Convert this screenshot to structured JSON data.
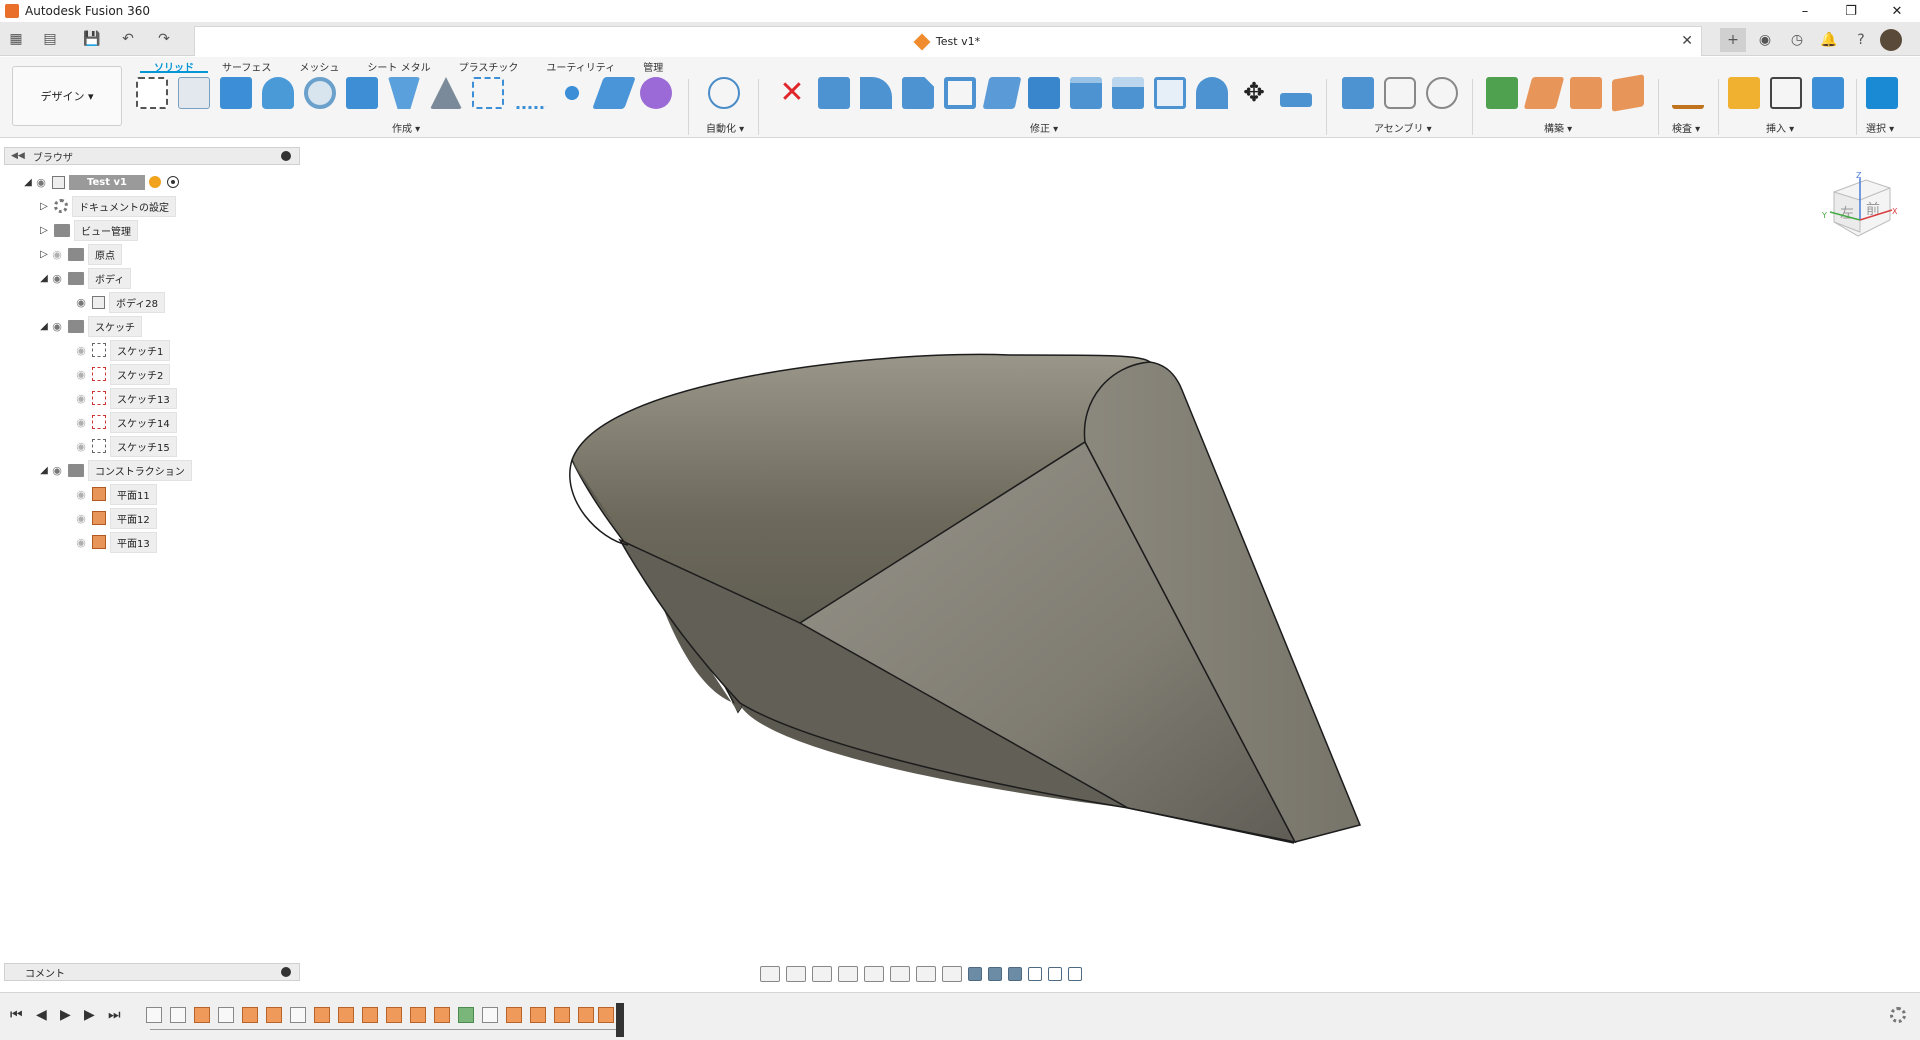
{
  "app_title": "Autodesk Fusion 360",
  "document_tab": {
    "title": "Test v1*"
  },
  "window_controls": [
    "–",
    "❐",
    "✕"
  ],
  "ribbon": {
    "workspace": "デザイン ▾",
    "tabs": [
      {
        "label": "ソリッド",
        "active": true
      },
      {
        "label": "サーフェス",
        "active": false
      },
      {
        "label": "メッシュ",
        "active": false
      },
      {
        "label": "シート メタル",
        "active": false
      },
      {
        "label": "プラスチック",
        "active": false
      },
      {
        "label": "ユーティリティ",
        "active": false
      },
      {
        "label": "管理",
        "active": false
      }
    ],
    "groups": {
      "create": "作成 ▾",
      "automate": "自動化 ▾",
      "modify": "修正 ▾",
      "assemble": "アセンブリ ▾",
      "construct": "構築 ▾",
      "inspect": "検査 ▾",
      "insert": "挿入 ▾",
      "select": "選択 ▾"
    }
  },
  "browser": {
    "title": "ブラウザ",
    "root": "Test v1",
    "items": {
      "doc_settings": "ドキュメントの設定",
      "view_mgmt": "ビュー管理",
      "origin": "原点",
      "bodies": "ボディ",
      "body28": "ボディ28",
      "sketches": "スケッチ",
      "sketch1": "スケッチ1",
      "sketch2": "スケッチ2",
      "sketch13": "スケッチ13",
      "sketch14": "スケッチ14",
      "sketch15": "スケッチ15",
      "construction": "コンストラクション",
      "plane11": "平面11",
      "plane12": "平面12",
      "plane13": "平面13"
    }
  },
  "viewcube": {
    "left": "左",
    "front": "前",
    "axis_x": "X",
    "axis_y": "Y",
    "axis_z": "Z"
  },
  "comments": {
    "title": "コメント"
  },
  "colors": {
    "accent": "#0696d7",
    "body_fill": "#777466",
    "delete_red": "#e0262a"
  }
}
